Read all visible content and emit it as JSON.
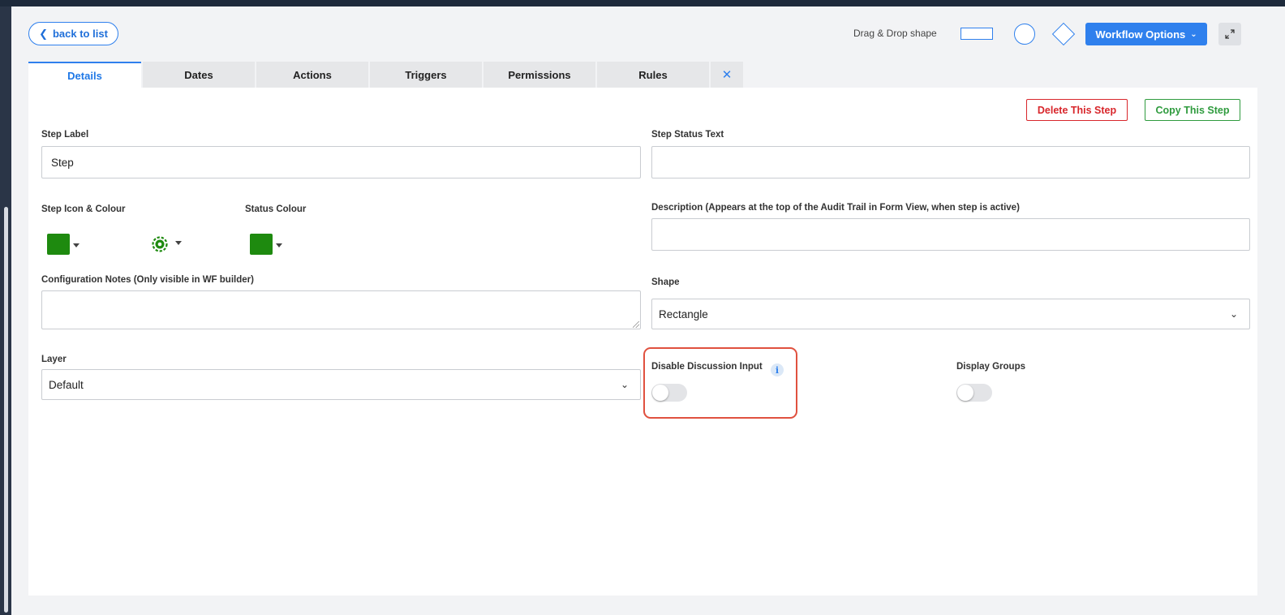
{
  "topbar": {
    "back_label": "back to list",
    "drag_drop_label": "Drag & Drop shape",
    "workflow_options_label": "Workflow Options"
  },
  "tabs": [
    {
      "label": "Details",
      "active": true
    },
    {
      "label": "Dates"
    },
    {
      "label": "Actions"
    },
    {
      "label": "Triggers"
    },
    {
      "label": "Permissions"
    },
    {
      "label": "Rules"
    }
  ],
  "actions": {
    "delete_label": "Delete This Step",
    "copy_label": "Copy This Step"
  },
  "form": {
    "step_label": {
      "label": "Step Label",
      "value": "Step"
    },
    "step_status_text": {
      "label": "Step Status Text",
      "value": ""
    },
    "step_icon_colour": {
      "label": "Step Icon & Colour",
      "color": "#1e8a0f",
      "icon": "gear-icon"
    },
    "status_colour": {
      "label": "Status Colour",
      "color": "#1e8a0f"
    },
    "description": {
      "label": "Description (Appears at the top of the Audit Trail in Form View, when step is active)",
      "value": ""
    },
    "config_notes": {
      "label": "Configuration Notes (Only visible in WF builder)",
      "value": ""
    },
    "shape": {
      "label": "Shape",
      "value": "Rectangle"
    },
    "layer": {
      "label": "Layer",
      "value": "Default"
    },
    "disable_discussion": {
      "label": "Disable Discussion Input",
      "enabled": false
    },
    "display_groups": {
      "label": "Display Groups",
      "enabled": false
    }
  },
  "colors": {
    "accent": "#2f80ed",
    "danger": "#d8262b",
    "success": "#2f9b3e",
    "highlight": "#e0513f"
  }
}
